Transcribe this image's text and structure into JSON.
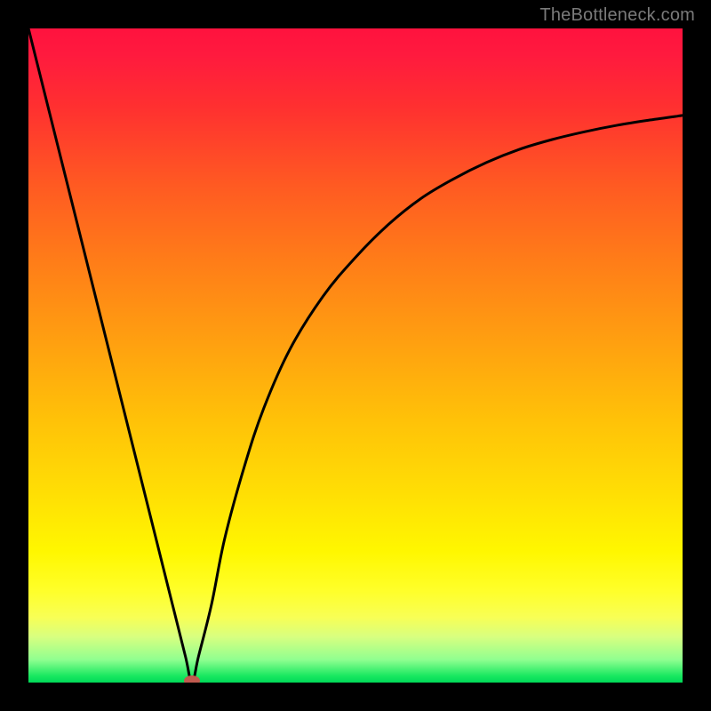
{
  "watermark": {
    "text": "TheBottleneck.com"
  },
  "chart_data": {
    "type": "line",
    "title": "",
    "xlabel": "",
    "ylabel": "",
    "xlim": [
      0,
      100
    ],
    "ylim": [
      0,
      100
    ],
    "grid": false,
    "background_gradient": {
      "direction": "vertical",
      "stops": [
        {
          "pos": 0.0,
          "color": "#FF123E"
        },
        {
          "pos": 0.5,
          "color": "#FFA010"
        },
        {
          "pos": 0.82,
          "color": "#FFF700"
        },
        {
          "pos": 0.93,
          "color": "#D8FF80"
        },
        {
          "pos": 1.0,
          "color": "#00D858"
        }
      ]
    },
    "series": [
      {
        "name": "bottleneck-curve",
        "color": "#000000",
        "x": [
          0,
          5,
          10,
          15,
          20,
          22,
          24,
          25,
          26,
          28,
          30,
          33,
          36,
          40,
          45,
          50,
          55,
          60,
          65,
          70,
          75,
          80,
          85,
          90,
          95,
          100
        ],
        "y": [
          100,
          80,
          60,
          40,
          20,
          12,
          4,
          0,
          4,
          12,
          22,
          33,
          42,
          51,
          59,
          65,
          70,
          74,
          77,
          79.5,
          81.5,
          83,
          84.2,
          85.2,
          86,
          86.7
        ]
      }
    ],
    "marker": {
      "x": 25,
      "y": 0,
      "color": "#C15A4F",
      "rx": 9,
      "ry": 6
    }
  }
}
